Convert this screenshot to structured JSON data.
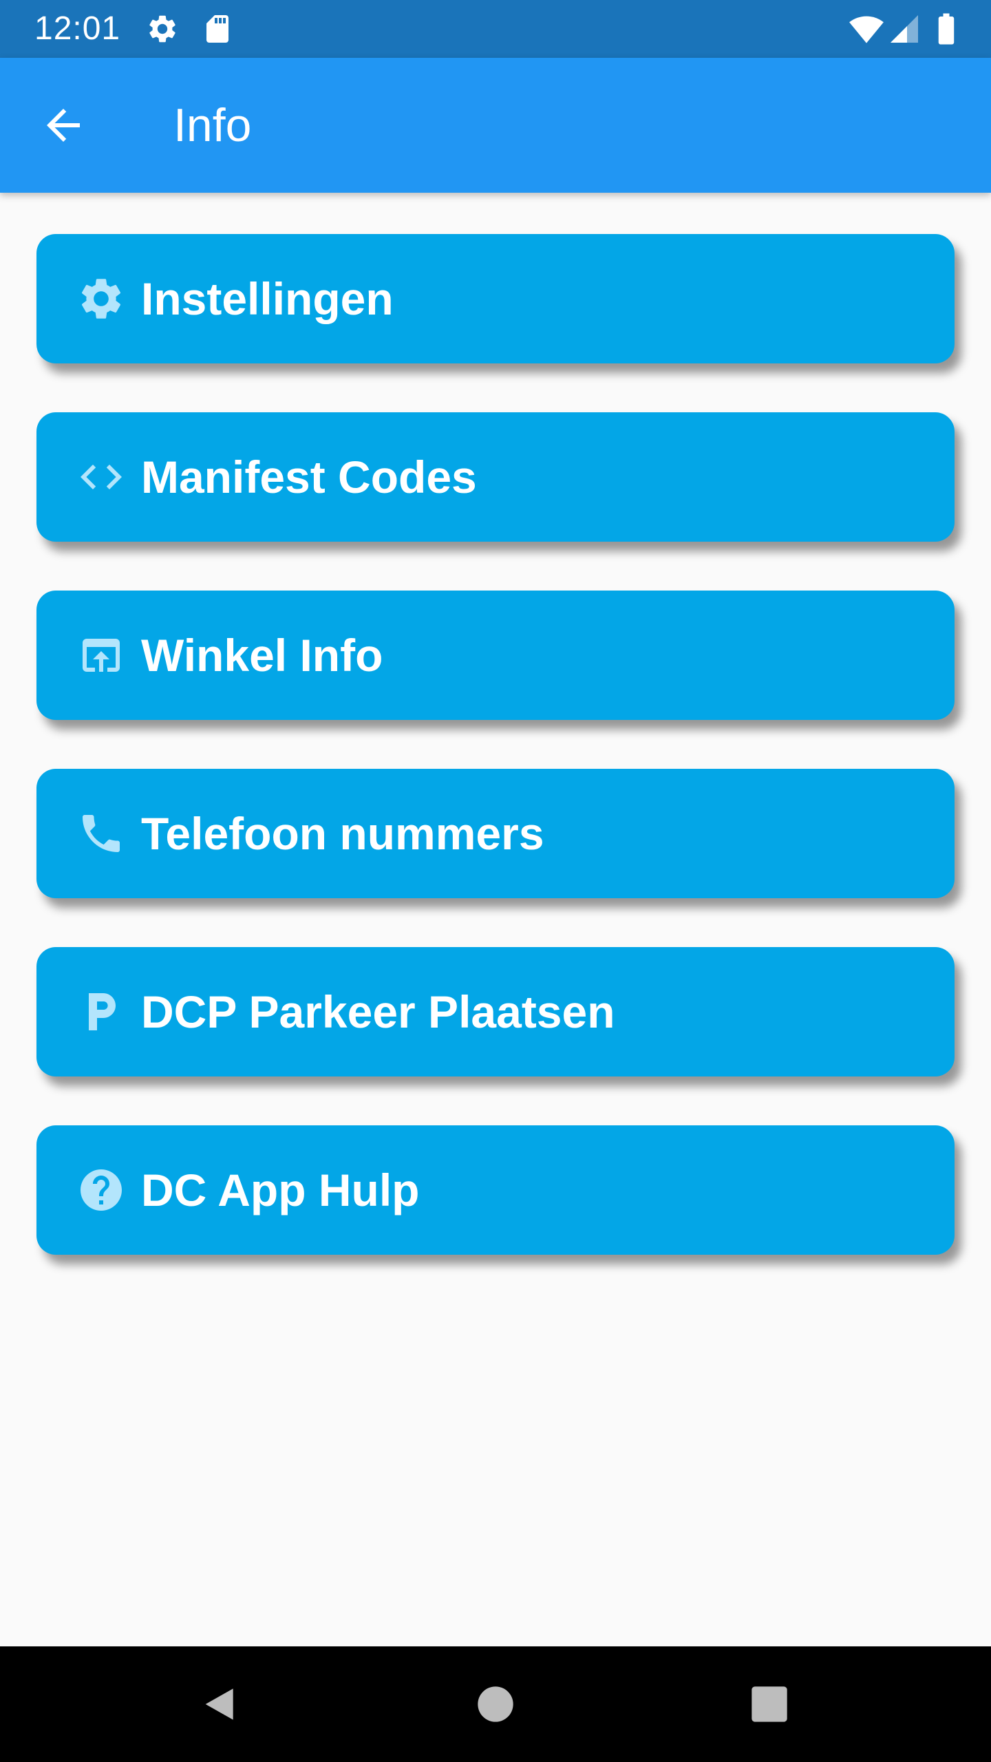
{
  "status_bar": {
    "time": "12:01",
    "left_icons": [
      "gear-icon",
      "sd-card-icon"
    ],
    "right_icons": [
      "wifi-icon",
      "cell-signal-icon",
      "battery-icon"
    ]
  },
  "app_bar": {
    "back_icon": "arrow-back-icon",
    "title": "Info"
  },
  "menu": {
    "items": [
      {
        "label": "Instellingen",
        "icon": "gear-icon"
      },
      {
        "label": "Manifest Codes",
        "icon": "code-icon"
      },
      {
        "label": "Winkel Info",
        "icon": "open-in-browser-icon"
      },
      {
        "label": "Telefoon nummers",
        "icon": "phone-icon"
      },
      {
        "label": "DCP Parkeer Plaatsen",
        "icon": "parking-icon"
      },
      {
        "label": "DC App Hulp",
        "icon": "help-circle-icon"
      }
    ]
  },
  "nav_bar": {
    "buttons": [
      "back-triangle-icon",
      "home-circle-icon",
      "recents-square-icon"
    ]
  },
  "colors": {
    "status_bar": "#1A74BA",
    "app_bar": "#2196F3",
    "card": "#03A6E7",
    "icon_tint": "#B3E5FC",
    "background": "#FAFAFA"
  }
}
